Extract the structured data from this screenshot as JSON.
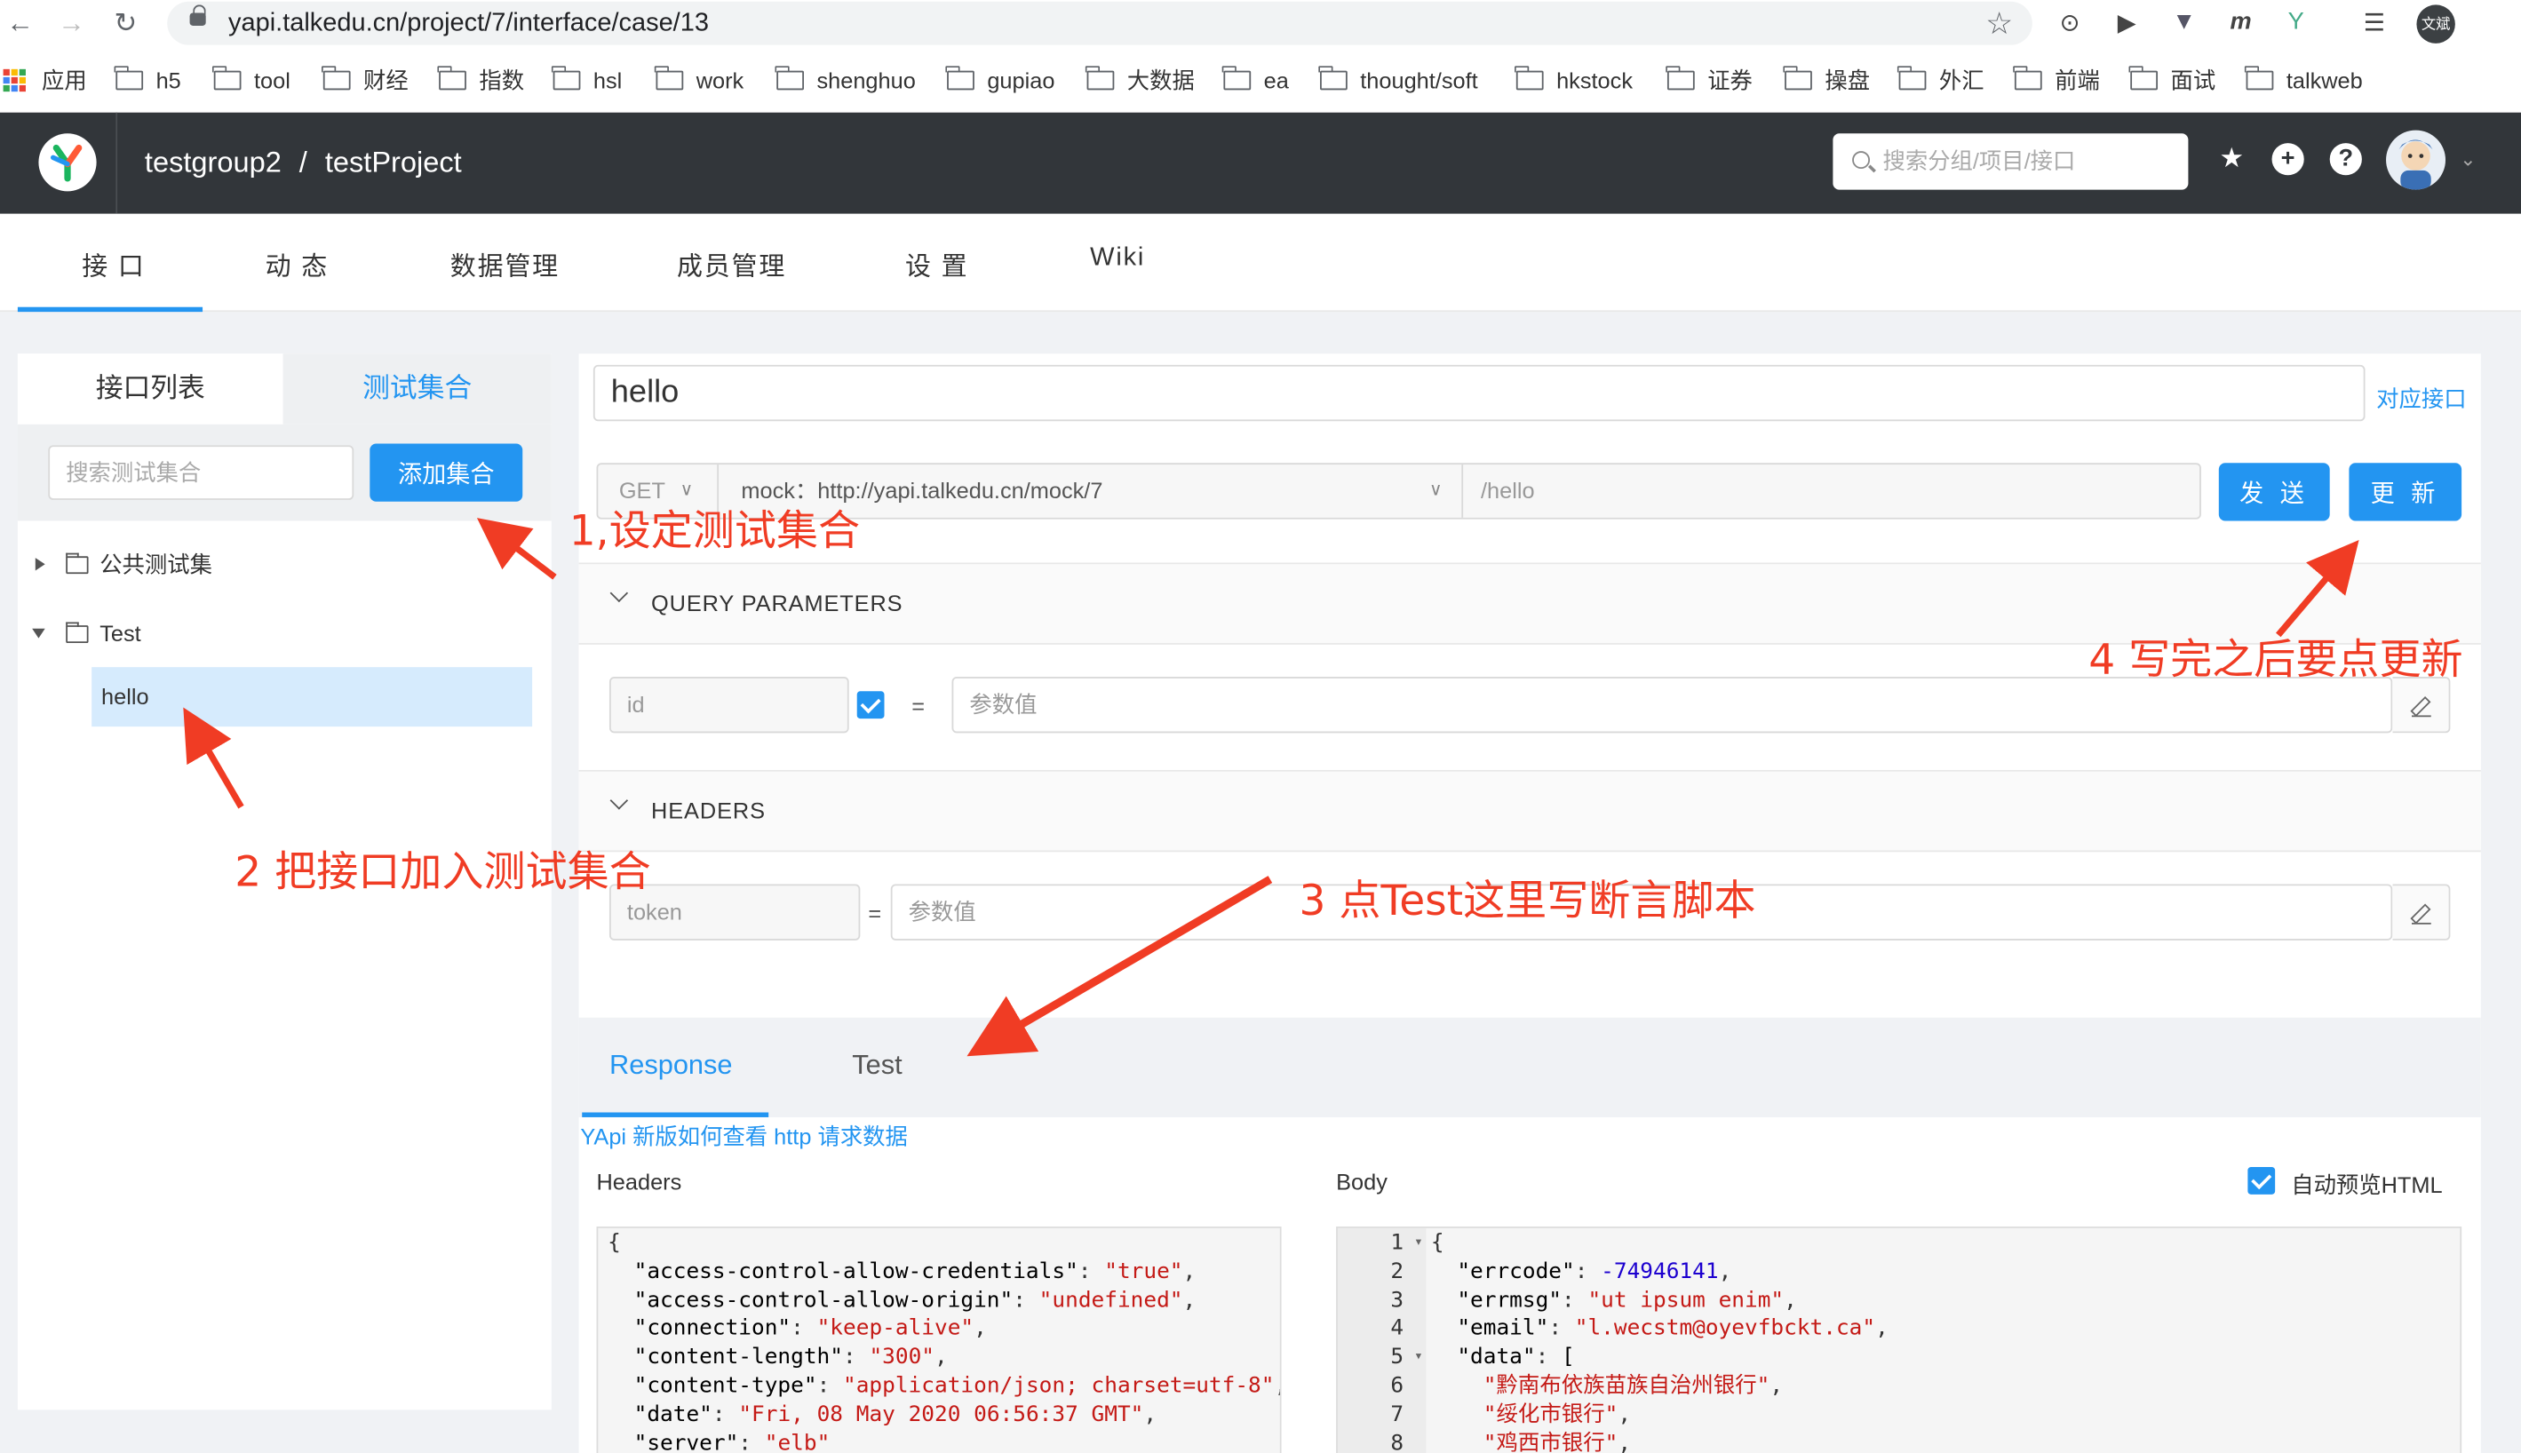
{
  "browser": {
    "url": "yapi.talkedu.cn/project/7/interface/case/13",
    "profile_badge": "文斌",
    "bookmarks": [
      "应用",
      "h5",
      "tool",
      "财经",
      "指数",
      "hsl",
      "work",
      "shenghuo",
      "gupiao",
      "大数据",
      "ea",
      "thought/soft",
      "hkstock",
      "证券",
      "操盘",
      "外汇",
      "前端",
      "面试",
      "talkweb"
    ]
  },
  "header": {
    "group": "testgroup2",
    "separator": "/",
    "project": "testProject",
    "search_placeholder": "搜索分组/项目/接口"
  },
  "nav_tabs": [
    "接 口",
    "动 态",
    "数据管理",
    "成员管理",
    "设 置",
    "Wiki"
  ],
  "sidebar": {
    "tab_list": "接口列表",
    "tab_collection": "测试集合",
    "search_placeholder": "搜索测试集合",
    "add_button": "添加集合",
    "tree": [
      {
        "label": "公共测试集",
        "expanded": false
      },
      {
        "label": "Test",
        "expanded": true,
        "children": [
          "hello"
        ]
      }
    ]
  },
  "case": {
    "name": "hello",
    "link_label": "对应接口",
    "method": "GET",
    "mock_url": "mock：http://yapi.talkedu.cn/mock/7",
    "path": "/hello",
    "send_button": "发 送",
    "update_button": "更 新",
    "query_title": "QUERY PARAMETERS",
    "query_param": {
      "key": "id",
      "value_placeholder": "参数值",
      "enabled": true
    },
    "headers_title": "HEADERS",
    "header_param": {
      "key": "token",
      "value_placeholder": "参数值"
    },
    "equals": "="
  },
  "result": {
    "tab_response": "Response",
    "tab_test": "Test",
    "help_link": "YApi 新版如何查看 http 请求数据",
    "headers_label": "Headers",
    "body_label": "Body",
    "auto_preview_label": "自动预览HTML",
    "auto_preview_checked": true,
    "headers_lines": [
      {
        "t": "{"
      },
      {
        "k": "  \"access-control-allow-credentials\"",
        "v": "\"true\"",
        "end": ","
      },
      {
        "k": "  \"access-control-allow-origin\"",
        "v": "\"undefined\"",
        "end": ","
      },
      {
        "k": "  \"connection\"",
        "v": "\"keep-alive\"",
        "end": ","
      },
      {
        "k": "  \"content-length\"",
        "v": "\"300\"",
        "end": ","
      },
      {
        "k": "  \"content-type\"",
        "v": "\"application/json; charset=utf-8\"",
        "end": ","
      },
      {
        "k": "  \"date\"",
        "v": "\"Fri, 08 May 2020 06:56:37 GMT\"",
        "end": ","
      },
      {
        "k": "  \"server\"",
        "v": "\"elb\"",
        "end": ""
      }
    ],
    "body_line_numbers": [
      "1",
      "2",
      "3",
      "4",
      "5",
      "6",
      "7",
      "8"
    ],
    "body_lines": [
      {
        "t": "{"
      },
      {
        "k": "  \"errcode\"",
        "v": "-74946141",
        "num": true,
        "end": ","
      },
      {
        "k": "  \"errmsg\"",
        "v": "\"ut ipsum enim\"",
        "end": ","
      },
      {
        "k": "  \"email\"",
        "v": "\"l.wecstm@oyevfbckt.ca\"",
        "end": ","
      },
      {
        "k": "  \"data\"",
        "v": "[",
        "plain": true,
        "end": ""
      },
      {
        "s": "    \"黔南布依族苗族自治州银行\"",
        "end": ","
      },
      {
        "s": "    \"绥化市银行\"",
        "end": ","
      },
      {
        "s": "    \"鸡西市银行\"",
        "end": ","
      }
    ]
  },
  "annotations": {
    "step1": "1,设定测试集合",
    "step2": "2 把接口加入测试集合",
    "step3": "3 点Test这里写断言脚本",
    "step4": "4 写完之后要点更新"
  },
  "colors": {
    "accent": "#2395f1",
    "header_bg": "#32363a",
    "annotation": "#f03c24"
  }
}
